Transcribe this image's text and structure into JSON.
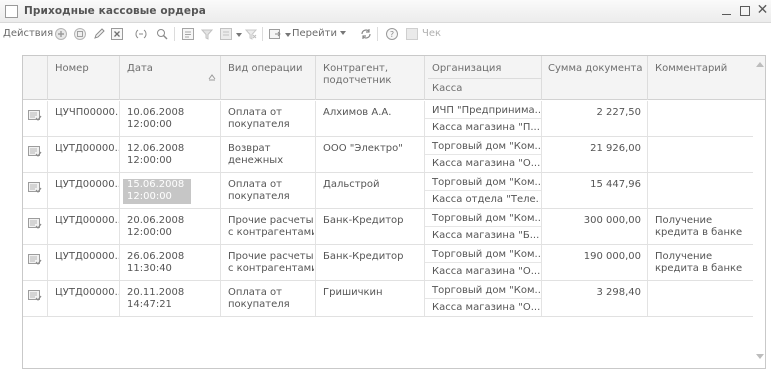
{
  "window": {
    "title": "Приходные кассовые ордера",
    "min_label": "_",
    "close_label": "✕"
  },
  "toolbar": {
    "actions_label": "Действия",
    "goto_label": "Перейти",
    "check_label": "Чек",
    "icons": [
      "add-icon",
      "copy-icon",
      "edit-icon",
      "delete-icon",
      "toggle-icon",
      "find-icon",
      "hierarchy-icon",
      "filter-icon",
      "filter-settings-icon",
      "clear-filter-icon",
      "print-icon",
      "refresh-icon",
      "help-icon",
      "receipt-icon"
    ]
  },
  "table": {
    "columns": {
      "number": "Номер",
      "date": "Дата",
      "operation": "Вид операции",
      "contragent_1": "Контрагент,",
      "contragent_2": "подотчетник",
      "organization": "Организация",
      "cashbox": "Касса",
      "sum": "Сумма документа",
      "comment": "Комментарий"
    },
    "rows": [
      {
        "number": "ЦУЧП00000...",
        "date": "10.06.2008",
        "time": "12:00:00",
        "op1": "Оплата от",
        "op2": "покупателя",
        "contragent": "Алхимов А.А.",
        "org": "ИЧП \"Предпринима...",
        "cash": "Касса магазина \"П...",
        "sum": "2 227,50",
        "c1": "",
        "c2": ""
      },
      {
        "number": "ЦУТД00000...",
        "date": "12.06.2008",
        "time": "12:00:00",
        "op1": "Возврат",
        "op2": "денежных",
        "contragent": "ООО \"Электро\"",
        "org": "Торговый дом \"Ком...",
        "cash": "Касса магазина \"О...",
        "sum": "21 926,00",
        "c1": "",
        "c2": ""
      },
      {
        "number": "ЦУТД00000...",
        "date": "15.06.2008",
        "time": "12:00:00",
        "op1": "Оплата от",
        "op2": "покупателя",
        "contragent": "Дальстрой",
        "org": "Торговый дом \"Ком...",
        "cash": "Касса отдела \"Теле...",
        "sum": "15 447,96",
        "c1": "",
        "c2": ""
      },
      {
        "number": "ЦУТД00000...",
        "date": "20.06.2008",
        "time": "12:00:00",
        "op1": "Прочие расчеты",
        "op2": "с контрагентами",
        "contragent": "Банк-Кредитор",
        "org": "Торговый дом \"Ком...",
        "cash": "Касса магазина \"Б...",
        "sum": "300 000,00",
        "c1": "Получение",
        "c2": "кредита в банке"
      },
      {
        "number": "ЦУТД00000...",
        "date": "26.06.2008",
        "time": "11:30:40",
        "op1": "Прочие расчеты",
        "op2": "с контрагентами",
        "contragent": "Банк-Кредитор",
        "org": "Торговый дом \"Ком...",
        "cash": "Касса магазина \"О...",
        "sum": "190 000,00",
        "c1": "Получение",
        "c2": "кредита в банке"
      },
      {
        "number": "ЦУТД00000...",
        "date": "20.11.2008",
        "time": "14:47:21",
        "op1": "Оплата от",
        "op2": "покупателя",
        "contragent": "Гришичкин",
        "org": "Торговый дом \"Ком...",
        "cash": "Касса магазина \"О...",
        "sum": "3 298,40",
        "c1": "",
        "c2": ""
      }
    ],
    "selected_row": 2
  }
}
